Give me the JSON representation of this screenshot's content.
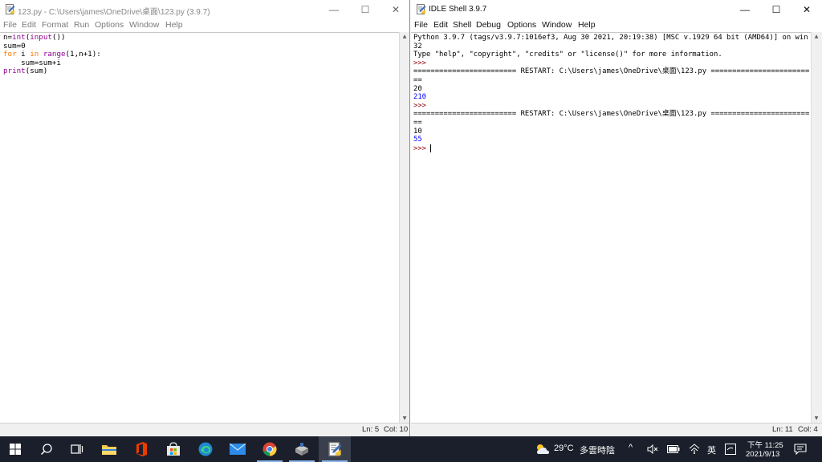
{
  "editor": {
    "title": "123.py - C:\\Users\\james\\OneDrive\\桌面\\123.py (3.9.7)",
    "menu": [
      "File",
      "Edit",
      "Format",
      "Run",
      "Options",
      "Window",
      "Help"
    ],
    "status": {
      "line": "Ln: 5",
      "col": "Col: 10"
    }
  },
  "shell": {
    "title": "IDLE Shell 3.9.7",
    "menu": [
      "File",
      "Edit",
      "Shell",
      "Debug",
      "Options",
      "Window",
      "Help"
    ],
    "banner_line1": "Python 3.9.7 (tags/v3.9.7:1016ef3, Aug 30 2021, 20:19:38) [MSC v.1929 64 bit (AMD64)] on win",
    "banner_line2": "32",
    "banner_line3": "Type \"help\", \"copyright\", \"credits\" or \"license()\" for more information.",
    "prompt": ">>>",
    "restart_line": "======================== RESTART: C:\\Users\\james\\OneDrive\\桌面\\123.py =======================",
    "restart_tail": "==",
    "run1_input": "20",
    "run1_output": "210",
    "run2_input": "10",
    "run2_output": "55",
    "status": {
      "line": "Ln: 11",
      "col": "Col: 4"
    }
  },
  "window_controls": {
    "minimize": "—",
    "maximize": "☐",
    "close": "✕"
  },
  "taskbar": {
    "weather_temp": "29°C",
    "weather_desc": "多雲時陰",
    "ime": "英",
    "time": "下午 11:25",
    "date": "2021/9/13"
  }
}
